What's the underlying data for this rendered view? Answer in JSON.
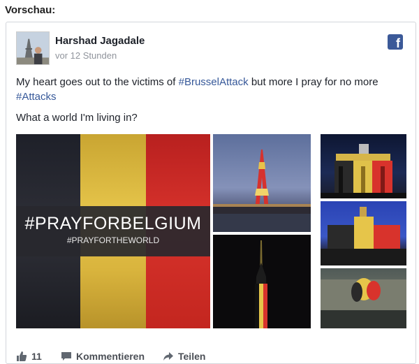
{
  "preview_label": "Vorschau:",
  "post": {
    "author": "Harshad Jagadale",
    "time": "vor 12 Stunden",
    "text_before": "My heart goes out to the victims of ",
    "hashtag1": "#BrusselAttack",
    "text_middle": " but more I pray for no more ",
    "hashtag2": "#Attacks",
    "text_line2": "What a world I'm living in?"
  },
  "media": {
    "main_text": "#PRAYFORBELGIUM",
    "sub_text": "#PRAYFORTHEWORLD"
  },
  "actions": {
    "like_count": "11",
    "comment_label": "Kommentieren",
    "share_label": "Teilen"
  },
  "colors": {
    "facebook_blue": "#3b5998",
    "hashtag": "#365899",
    "belgium_black": "#1e2029",
    "belgium_yellow": "#e6c54a",
    "belgium_red": "#d8332c"
  },
  "icons": {
    "brand": "facebook-icon",
    "like": "thumbs-up-icon",
    "comment": "comment-icon",
    "share": "share-arrow-icon"
  }
}
